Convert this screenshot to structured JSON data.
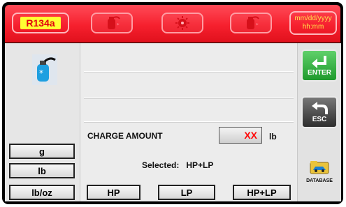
{
  "header": {
    "refrigerant": "R134a",
    "datetime_line1": "mm/dd/yyyy",
    "datetime_line2": "hh:mm",
    "icons": [
      "tank-dispense-icon",
      "gear-spinner-icon",
      "tank-recover-icon"
    ]
  },
  "units": {
    "g": "g",
    "lb": "lb",
    "lboz": "lb/oz"
  },
  "charge": {
    "label": "CHARGE AMOUNT",
    "value": "XX",
    "unit": "lb"
  },
  "selection": {
    "text": "Selected:   HP+LP"
  },
  "modes": {
    "hp": "HP",
    "lp": "LP",
    "hplp": "HP+LP"
  },
  "side": {
    "enter": "ENTER",
    "esc": "ESC",
    "database": "DATABASE"
  },
  "colors": {
    "header_red": "#f6202e",
    "refrigerant_bg": "#ffff32",
    "value_red": "#ff0a0a",
    "enter_green": "#2fae3c"
  }
}
